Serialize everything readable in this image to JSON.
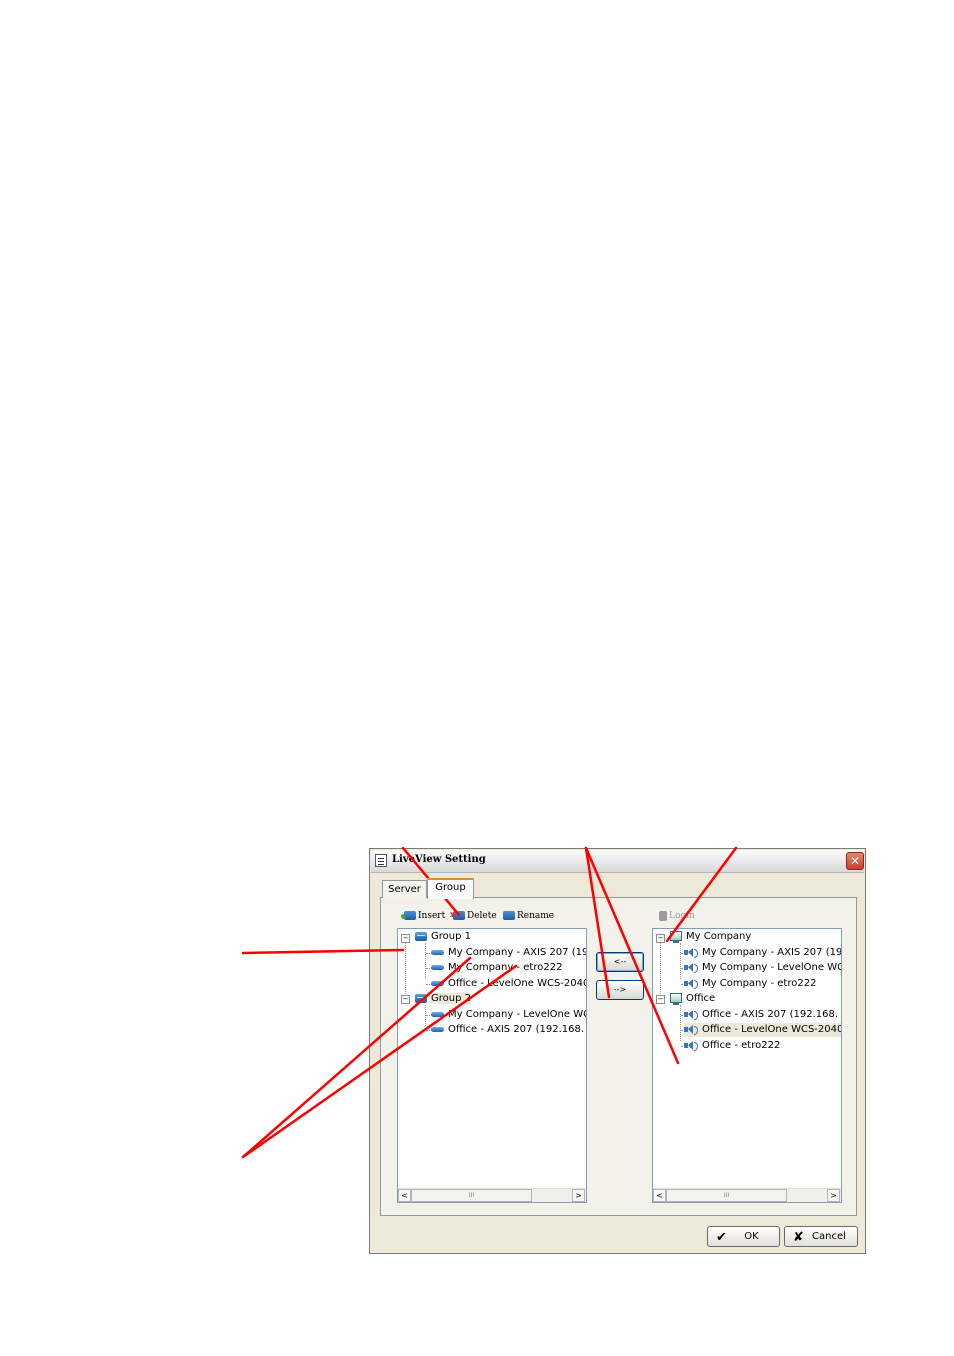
{
  "window": {
    "title": "LiveView Setting",
    "close_glyph": "✕"
  },
  "tabs": [
    {
      "label": "Server",
      "active": false
    },
    {
      "label": "Group",
      "active": true
    }
  ],
  "toolbar": {
    "insert": "Insert",
    "delete": "Delete",
    "rename": "Rename",
    "login": "Login"
  },
  "left_tree": {
    "groups": [
      {
        "label": "Group 1",
        "expander": "−",
        "items": [
          "My Company - AXIS 207 (19",
          "My Company - etro222",
          "Office - LevelOne WCS-2040"
        ]
      },
      {
        "label": "Group 2",
        "expander": "−",
        "items": [
          "My Company - LevelOne WC",
          "Office - AXIS 207 (192.168."
        ]
      }
    ]
  },
  "right_tree": {
    "servers": [
      {
        "label": "My Company",
        "expander": "−",
        "items": [
          "My Company - AXIS 207 (19",
          "My Company - LevelOne WC",
          "My Company - etro222"
        ]
      },
      {
        "label": "Office",
        "expander": "−",
        "items": [
          "Office - AXIS 207 (192.168.",
          "Office - LevelOne WCS-2040",
          "Office - etro222"
        ]
      }
    ]
  },
  "transfer": {
    "add_label": "<--",
    "remove_label": "-->"
  },
  "scrollbar": {
    "left_arrow": "<",
    "right_arrow": ">",
    "thumb_grip": "III"
  },
  "footer": {
    "ok_label": "OK",
    "cancel_label": "Cancel",
    "ok_glyph": "✔",
    "cancel_glyph": "✘"
  },
  "colors": {
    "callout_lines": "#ff0000",
    "dialog_bg": "#ece9d8",
    "tab_accent": "#e68b2c"
  }
}
